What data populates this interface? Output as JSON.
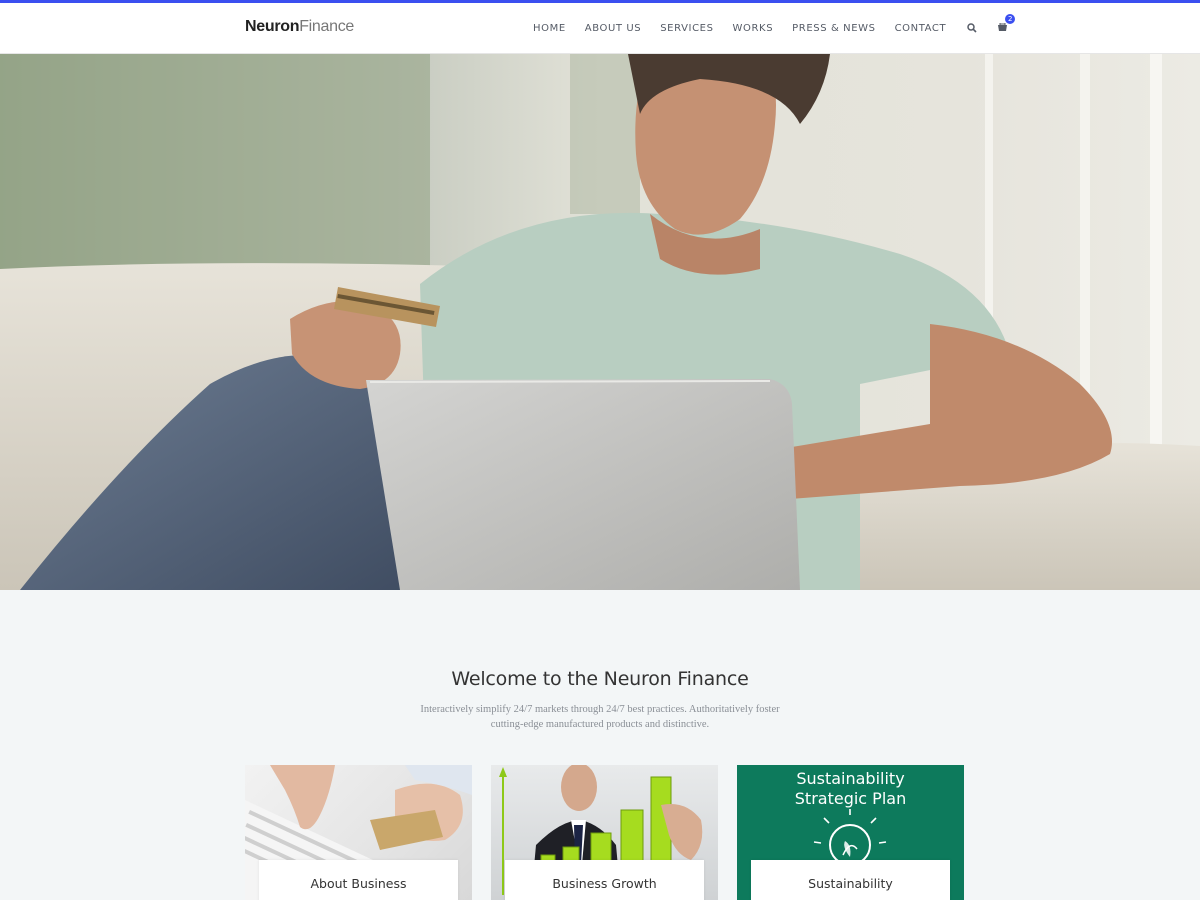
{
  "brand": {
    "name_bold": "Neuron",
    "name_light": "Finance"
  },
  "nav": {
    "items": [
      "HOME",
      "ABOUT US",
      "SERVICES",
      "WORKS",
      "PRESS & NEWS",
      "CONTACT"
    ],
    "cart_count": "2"
  },
  "welcome": {
    "title": "Welcome to the Neuron Finance",
    "text": "Interactively simplify 24/7 markets through 24/7 best practices. Authoritatively foster cutting-edge manufactured products and distinctive."
  },
  "cards": [
    {
      "label": "About Business"
    },
    {
      "label": "Business Growth"
    },
    {
      "label": "Sustainability",
      "image_text_line1": "Sustainability",
      "image_text_line2": "Strategic Plan"
    }
  ],
  "colors": {
    "accent": "#3b4ff0",
    "green": "#0d7a5c"
  }
}
